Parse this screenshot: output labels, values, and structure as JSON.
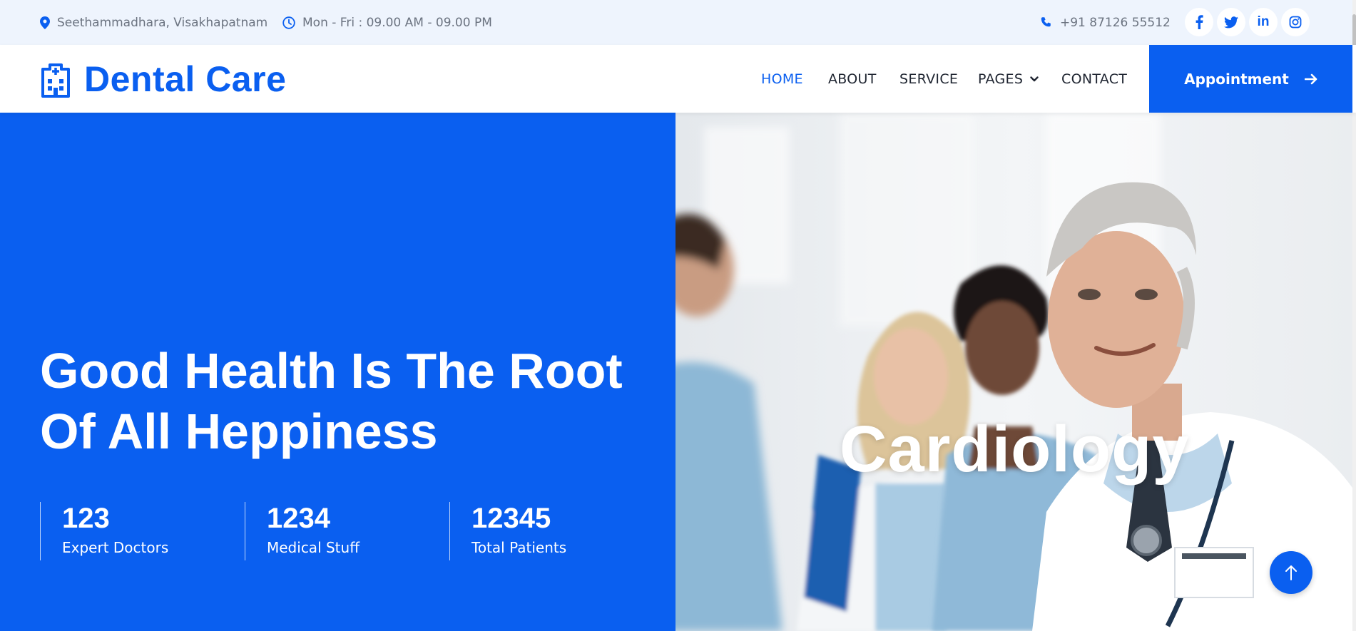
{
  "topbar": {
    "address": "Seethammadhara, Visakhapatnam",
    "hours": "Mon - Fri : 09.00 AM - 09.00 PM",
    "phone": "+91 87126 55512",
    "social": [
      {
        "label": "f",
        "icon": "facebook-icon"
      },
      {
        "label": "twitter",
        "icon": "twitter-icon"
      },
      {
        "label": "in",
        "icon": "linkedin-icon"
      },
      {
        "label": "instagram",
        "icon": "instagram-icon"
      }
    ]
  },
  "nav": {
    "brand": "Dental Care",
    "links": [
      "HOME",
      "ABOUT",
      "SERVICE",
      "PAGES",
      "CONTACT"
    ],
    "active": "HOME",
    "cta": "Appointment"
  },
  "hero": {
    "title_line1": "Good Health Is The Root",
    "title_line2": "Of All Heppiness",
    "stats": [
      {
        "value": "123",
        "label": "Expert Doctors"
      },
      {
        "value": "1234",
        "label": "Medical Stuff"
      },
      {
        "value": "12345",
        "label": "Total Patients"
      }
    ],
    "overlay_text": "Cardiology"
  },
  "colors": {
    "primary": "#0a5ff0",
    "topbar_bg": "#eef4fd"
  }
}
